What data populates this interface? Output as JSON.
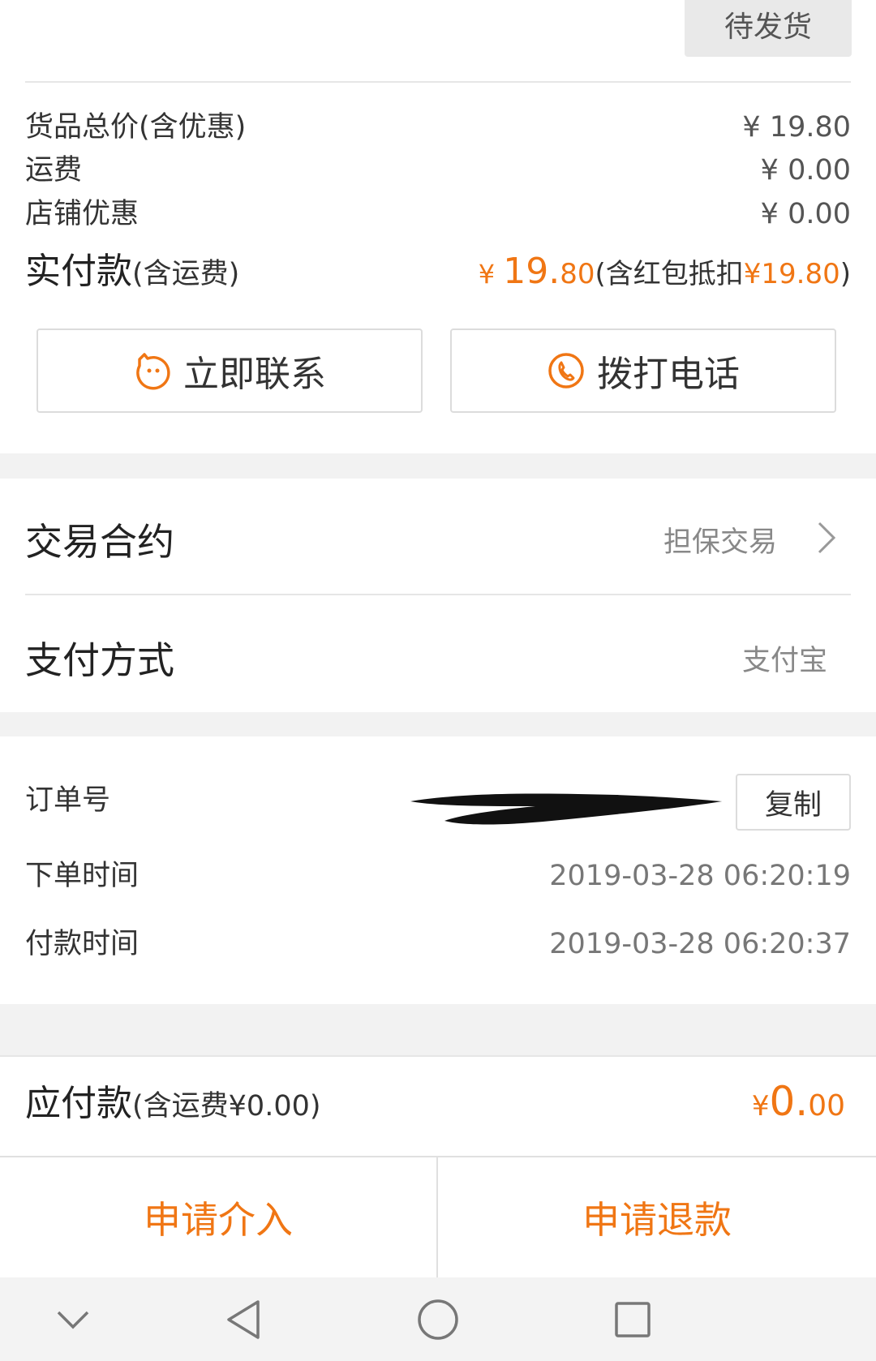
{
  "order_status": "待发货",
  "summary": {
    "goods_total_label": "货品总价(含优惠)",
    "goods_total_value": "¥ 19.80",
    "shipping_label": "运费",
    "shipping_value": "¥ 0.00",
    "shop_discount_label": "店铺优惠",
    "shop_discount_value": "¥ 0.00",
    "paid_label_main": "实付款",
    "paid_label_sub": "(含运费)",
    "paid_currency": "¥ ",
    "paid_integer": "19.",
    "paid_decimal": "80",
    "paid_note_prefix": "(含红包抵扣",
    "paid_note_amount": "¥19.80",
    "paid_note_suffix": ")"
  },
  "actions": {
    "contact_label": "立即联系",
    "call_label": "拨打电话"
  },
  "trade": {
    "contract_label": "交易合约",
    "contract_value": "担保交易",
    "payment_label": "支付方式",
    "payment_value": "支付宝"
  },
  "order_info": {
    "order_no_label": "订单号",
    "copy_label": "复制",
    "created_label": "下单时间",
    "created_value": "2019-03-28 06:20:19",
    "paid_time_label": "付款时间",
    "paid_time_value": "2019-03-28 06:20:37"
  },
  "payable": {
    "label_main": "应付款",
    "label_sub": "(含运费¥0.00)",
    "currency": "¥",
    "integer": "0.",
    "decimal": "00"
  },
  "bottom_actions": {
    "intervene_label": "申请介入",
    "refund_label": "申请退款"
  },
  "colors": {
    "accent": "#f07614",
    "background": "#f2f2f2"
  }
}
